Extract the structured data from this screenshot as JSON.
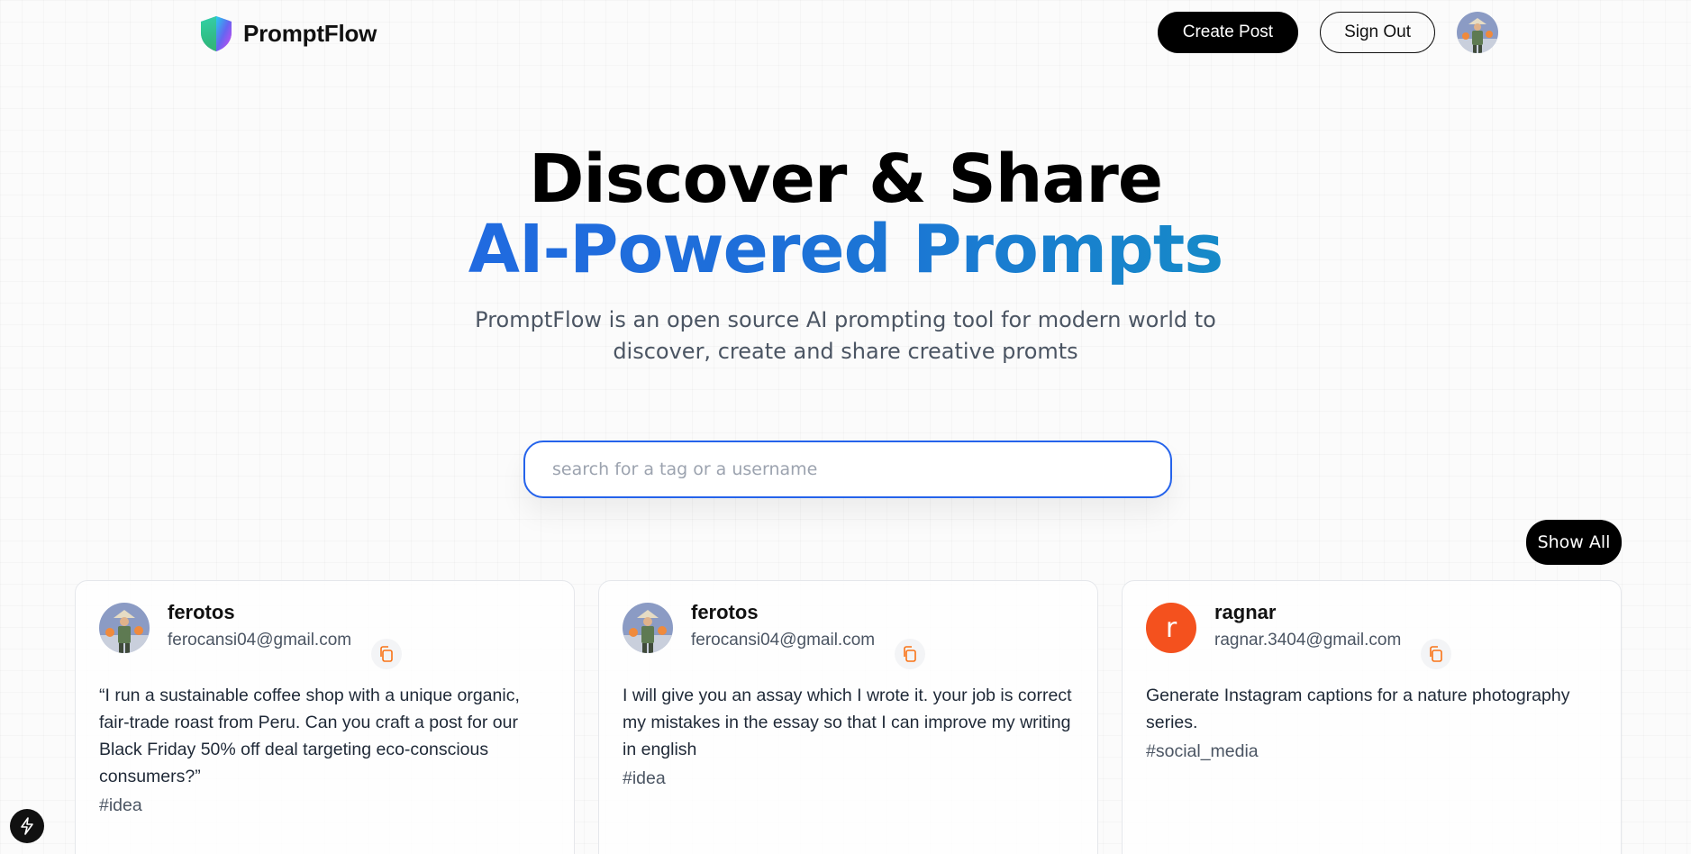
{
  "nav": {
    "brand_name": "PromptFlow",
    "create_post_label": "Create Post",
    "sign_out_label": "Sign Out",
    "profile_avatar_icon": "user-avatar-icon"
  },
  "hero": {
    "line1": "Discover & Share",
    "line2": "AI-Powered Prompts",
    "subtitle": "PromptFlow is an open source AI prompting tool for modern world to discover, create and share creative promts"
  },
  "search": {
    "placeholder": "search for a tag or a username",
    "value": ""
  },
  "show_all_label": "Show All",
  "colors": {
    "accent_blue": "#2563eb",
    "gradient_end": "#0ea5b7",
    "copy_icon": "#f97316",
    "letter_avatar_bg": "#f4511e"
  },
  "cards": [
    {
      "username": "ferotos",
      "email": "ferocansi04@gmail.com",
      "prompt": "“I run a sustainable coffee shop with a unique organic, fair-trade roast from Peru. Can you craft a post for our Black Friday 50% off deal targeting eco-conscious consumers?”",
      "tag": "#idea",
      "avatar": "photo"
    },
    {
      "username": "ferotos",
      "email": "ferocansi04@gmail.com",
      "prompt": "I will give you an assay which I wrote it. your job is correct my mistakes in the essay so that I can improve my writing in english",
      "tag": "#idea",
      "avatar": "photo"
    },
    {
      "username": "ragnar",
      "email": "ragnar.3404@gmail.com",
      "prompt": "Generate Instagram captions for a nature photography series.",
      "tag": "#social_media",
      "avatar": "letter",
      "avatar_letter": "r"
    }
  ]
}
